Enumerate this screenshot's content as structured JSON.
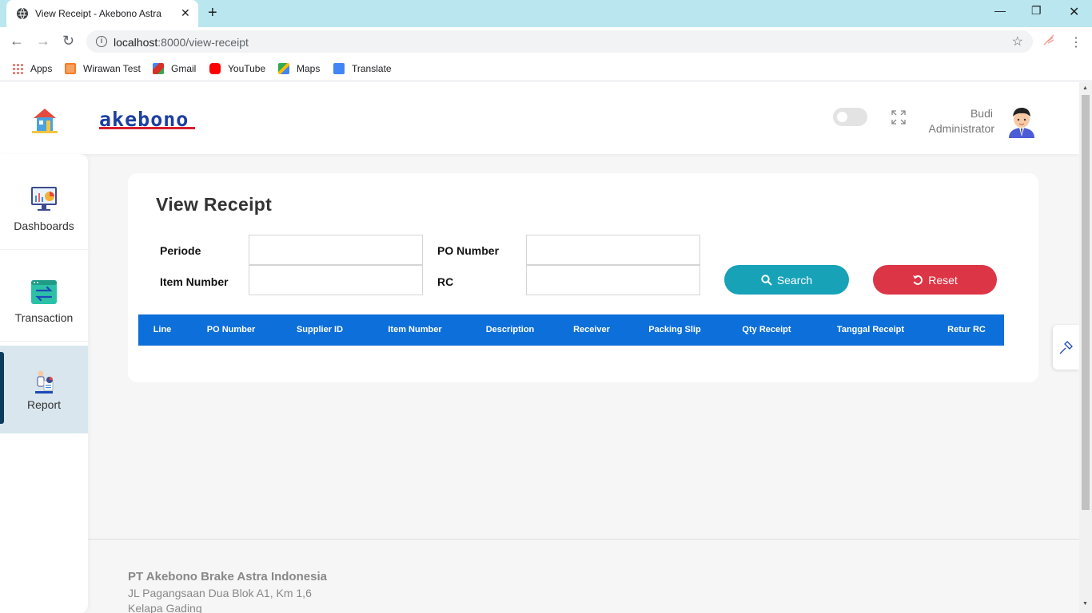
{
  "browser": {
    "tab_title": "View Receipt - Akebono Astra",
    "url_host": "localhost",
    "url_path": ":8000/view-receipt",
    "bookmarks": [
      {
        "label": "Apps",
        "color": "#ea4335"
      },
      {
        "label": "Wirawan Test",
        "color": "#f4a261"
      },
      {
        "label": "Gmail",
        "color": "#d93025"
      },
      {
        "label": "YouTube",
        "color": "#ff0000"
      },
      {
        "label": "Maps",
        "color": "#34a853"
      },
      {
        "label": "Translate",
        "color": "#4285f4"
      }
    ]
  },
  "header": {
    "logo_text": "akebono",
    "user_name": "Budi",
    "user_role": "Administrator",
    "dark_mode_toggle": "off"
  },
  "sidebar": {
    "items": [
      {
        "label": "Dashboards",
        "icon": "dashboard-chart-icon",
        "active": false
      },
      {
        "label": "Transaction",
        "icon": "transaction-arrows-icon",
        "active": false
      },
      {
        "label": "Report",
        "icon": "report-person-icon",
        "active": true
      }
    ]
  },
  "main": {
    "title": "View Receipt",
    "form": {
      "periode_label": "Periode",
      "periode_value": "",
      "po_number_label": "PO Number",
      "po_number_value": "",
      "item_number_label": "Item Number",
      "item_number_value": "",
      "rc_label": "RC",
      "rc_value": ""
    },
    "search_button": "Search",
    "reset_button": "Reset",
    "table_columns": [
      "Line",
      "PO Number",
      "Supplier ID",
      "Item Number",
      "Description",
      "Receiver",
      "Packing Slip",
      "Qty Receipt",
      "Tanggal Receipt",
      "Retur RC"
    ]
  },
  "footer": {
    "company": "PT Akebono Brake Astra Indonesia",
    "address": "JL Pagangsaan Dua Blok A1, Km 1,6",
    "city": "Kelapa Gading"
  },
  "colors": {
    "accent_blue": "#0d6fd9",
    "search_button": "#17a2b8",
    "reset_button": "#dc3545",
    "sidebar_active": "#d9e6ee",
    "logo_blue": "#1c3fa0",
    "logo_red": "#d61f2e"
  }
}
